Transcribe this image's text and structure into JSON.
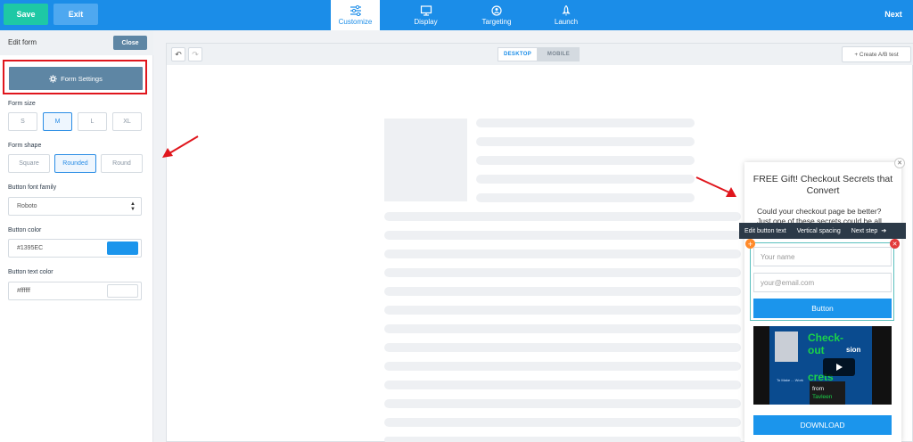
{
  "topbar": {
    "save_label": "Save",
    "exit_label": "Exit",
    "next_label": "Next",
    "tabs": [
      {
        "label": "Customize",
        "icon": "sliders-icon",
        "active": true
      },
      {
        "label": "Display",
        "icon": "monitor-icon",
        "active": false
      },
      {
        "label": "Targeting",
        "icon": "target-icon",
        "active": false
      },
      {
        "label": "Launch",
        "icon": "rocket-icon",
        "active": false
      }
    ],
    "colors": {
      "bar": "#1b8de8",
      "save": "#1ec8a5",
      "exit": "#4ea8f0"
    }
  },
  "sidebar": {
    "title": "Edit form",
    "close_label": "Close",
    "form_settings_label": "Form Settings",
    "form_size_label": "Form size",
    "form_sizes": [
      "S",
      "M",
      "L",
      "XL"
    ],
    "form_size_selected": "M",
    "form_shape_label": "Form shape",
    "form_shapes": [
      "Square",
      "Rounded",
      "Round"
    ],
    "form_shape_selected": "Rounded",
    "font_family_label": "Button font family",
    "font_family_value": "Roboto",
    "button_color_label": "Button color",
    "button_color_value": "#1395EC",
    "button_text_color_label": "Button text color",
    "button_text_color_value": "#ffffff"
  },
  "canvas": {
    "device_desktop": "DESKTOP",
    "device_mobile": "MOBILE",
    "ab_test_label": "+ Create A/B test"
  },
  "popup": {
    "title": "FREE Gift! Checkout Secrets that Convert",
    "body": "Could your checkout page be better? Just one of these secrets could be all",
    "edit_toolbar": [
      "Edit button text",
      "Vertical spacing",
      "Next step"
    ],
    "name_placeholder": "Your name",
    "email_placeholder": "your@email.com",
    "button_label": "Button",
    "video": {
      "line1": "Check-",
      "line2": "out",
      "line3": "crets",
      "side_text": "sion",
      "from_label": "from",
      "author": "Tavleen",
      "small_text": "To Make ... Work"
    },
    "download_label": "DOWNLOAD"
  }
}
